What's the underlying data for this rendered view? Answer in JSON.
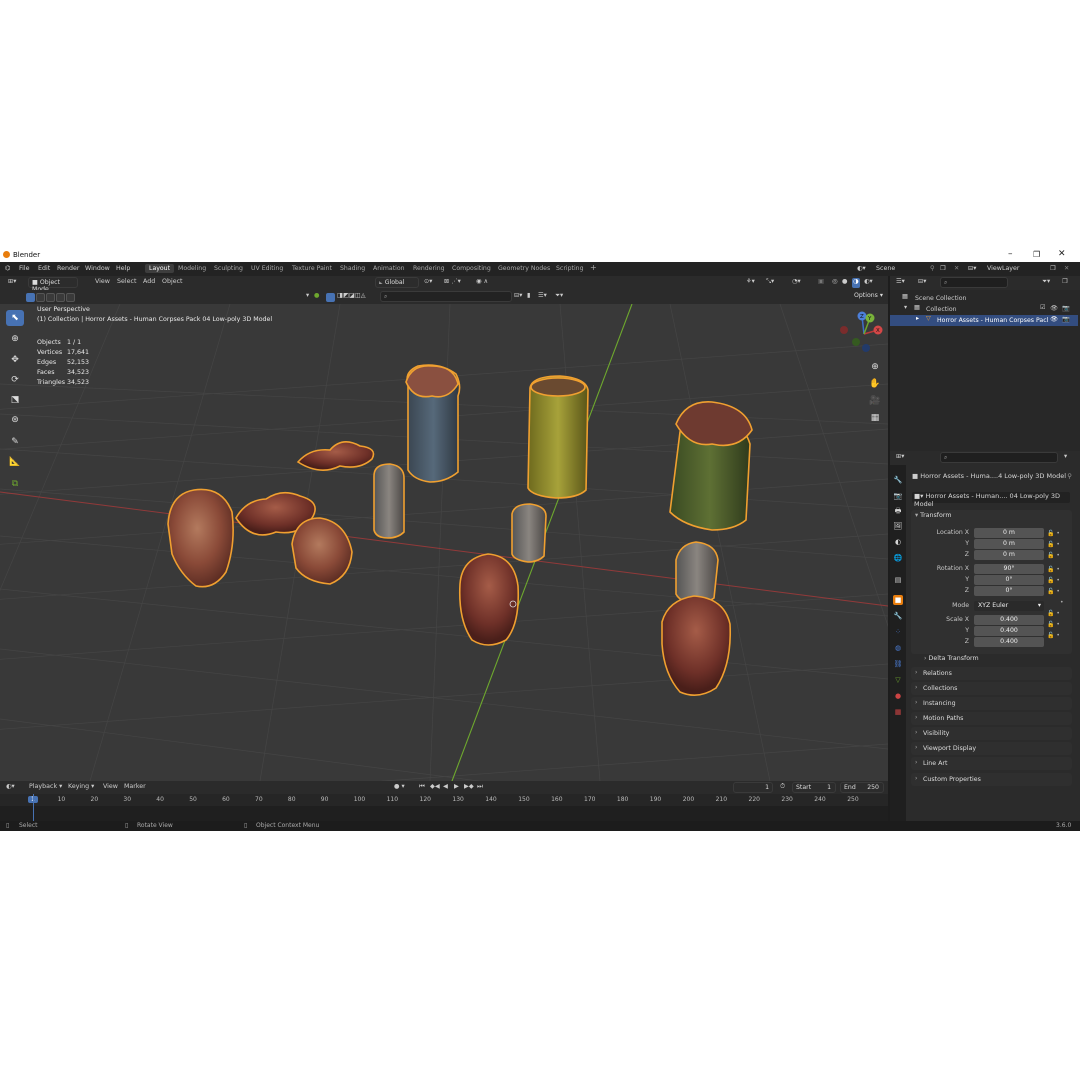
{
  "window": {
    "title": "Blender"
  },
  "menu": [
    "File",
    "Edit",
    "Render",
    "Window",
    "Help"
  ],
  "workspaces": [
    "Layout",
    "Modeling",
    "Sculpting",
    "UV Editing",
    "Texture Paint",
    "Shading",
    "Animation",
    "Rendering",
    "Compositing",
    "Geometry Nodes",
    "Scripting"
  ],
  "scene": {
    "name": "Scene",
    "view_layer": "ViewLayer"
  },
  "viewport_header": {
    "mode": "Object Mode",
    "menus": [
      "View",
      "Select",
      "Add",
      "Object"
    ],
    "orientation": "Global",
    "options": "Options"
  },
  "viewport": {
    "view_name": "User Perspective",
    "collection_line": "(1) Collection | Horror Assets - Human Corpses Pack 04 Low-poly 3D Model",
    "stats": [
      {
        "label": "Objects",
        "value": "1 / 1"
      },
      {
        "label": "Vertices",
        "value": "17,641"
      },
      {
        "label": "Edges",
        "value": "52,153"
      },
      {
        "label": "Faces",
        "value": "34,523"
      },
      {
        "label": "Triangles",
        "value": "34,523"
      }
    ],
    "gizmo": {
      "x": "X",
      "y": "Y",
      "z": "Z"
    }
  },
  "outliner": {
    "rows": [
      {
        "label": "Scene Collection"
      },
      {
        "label": "Collection"
      },
      {
        "label": "Horror Assets - Human Corpses Pacl"
      }
    ]
  },
  "properties": {
    "object_name": "Horror Assets - Huma....4 Low-poly 3D Model",
    "data_name": "Horror Assets - Human.... 04 Low-poly 3D Model",
    "transform": {
      "title": "Transform",
      "location_label": "Location X",
      "location": [
        "0 m",
        "0 m",
        "0 m"
      ],
      "rotation_label": "Rotation X",
      "rotation": [
        "90°",
        "0°",
        "0°"
      ],
      "mode_label": "Mode",
      "mode": "XYZ Euler",
      "scale_label": "Scale X",
      "scale": [
        "0.400",
        "0.400",
        "0.400"
      ],
      "y": "Y",
      "z": "Z"
    },
    "delta": "Delta Transform",
    "panels": [
      "Relations",
      "Collections",
      "Instancing",
      "Motion Paths",
      "Visibility",
      "Viewport Display",
      "Line Art",
      "Custom Properties"
    ]
  },
  "timeline": {
    "menus": [
      "Playback",
      "Keying",
      "View",
      "Marker"
    ],
    "current_frame": "1",
    "start_label": "Start",
    "start": "1",
    "end_label": "End",
    "end": "250",
    "ticks": [
      "1",
      "10",
      "20",
      "30",
      "40",
      "50",
      "60",
      "70",
      "80",
      "90",
      "100",
      "110",
      "120",
      "130",
      "140",
      "150",
      "160",
      "170",
      "180",
      "190",
      "200",
      "210",
      "220",
      "230",
      "240",
      "250"
    ]
  },
  "statusbar": {
    "select": "Select",
    "rotate": "Rotate View",
    "context": "Object Context Menu",
    "version": "3.6.0"
  },
  "colors": {
    "accent": "#4772b3",
    "selection_outline": "#f0a030",
    "x_axis": "#b83a3a",
    "y_axis": "#6ea82e"
  }
}
